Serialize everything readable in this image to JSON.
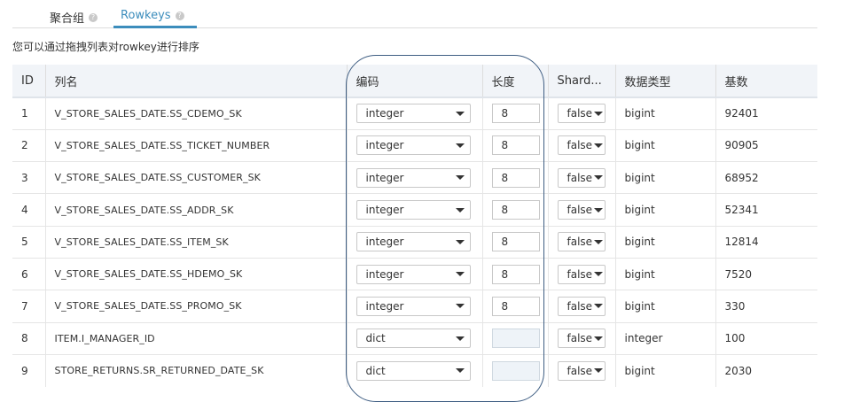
{
  "tabs": [
    {
      "label": "聚合组",
      "active": false
    },
    {
      "label": "Rowkeys",
      "active": true
    }
  ],
  "hint": "您可以通过拖拽列表对rowkey进行排序",
  "accent_color": "#3c8dbc",
  "table": {
    "headers": {
      "id": "ID",
      "name": "列名",
      "encoding": "编码",
      "length": "长度",
      "shard": "Shard...",
      "type": "数据类型",
      "cardinality": "基数"
    },
    "rows": [
      {
        "id": "1",
        "name": "V_STORE_SALES_DATE.SS_CDEMO_SK",
        "encoding": "integer",
        "length": "8",
        "shard": "false",
        "type": "bigint",
        "cardinality": "92401"
      },
      {
        "id": "2",
        "name": "V_STORE_SALES_DATE.SS_TICKET_NUMBER",
        "encoding": "integer",
        "length": "8",
        "shard": "false",
        "type": "bigint",
        "cardinality": "90905"
      },
      {
        "id": "3",
        "name": "V_STORE_SALES_DATE.SS_CUSTOMER_SK",
        "encoding": "integer",
        "length": "8",
        "shard": "false",
        "type": "bigint",
        "cardinality": "68952"
      },
      {
        "id": "4",
        "name": "V_STORE_SALES_DATE.SS_ADDR_SK",
        "encoding": "integer",
        "length": "8",
        "shard": "false",
        "type": "bigint",
        "cardinality": "52341"
      },
      {
        "id": "5",
        "name": "V_STORE_SALES_DATE.SS_ITEM_SK",
        "encoding": "integer",
        "length": "8",
        "shard": "false",
        "type": "bigint",
        "cardinality": "12814"
      },
      {
        "id": "6",
        "name": "V_STORE_SALES_DATE.SS_HDEMO_SK",
        "encoding": "integer",
        "length": "8",
        "shard": "false",
        "type": "bigint",
        "cardinality": "7520"
      },
      {
        "id": "7",
        "name": "V_STORE_SALES_DATE.SS_PROMO_SK",
        "encoding": "integer",
        "length": "8",
        "shard": "false",
        "type": "bigint",
        "cardinality": "330"
      },
      {
        "id": "8",
        "name": "ITEM.I_MANAGER_ID",
        "encoding": "dict",
        "length": "",
        "shard": "false",
        "type": "integer",
        "cardinality": "100"
      },
      {
        "id": "9",
        "name": "STORE_RETURNS.SR_RETURNED_DATE_SK",
        "encoding": "dict",
        "length": "",
        "shard": "false",
        "type": "bigint",
        "cardinality": "2030"
      }
    ]
  }
}
